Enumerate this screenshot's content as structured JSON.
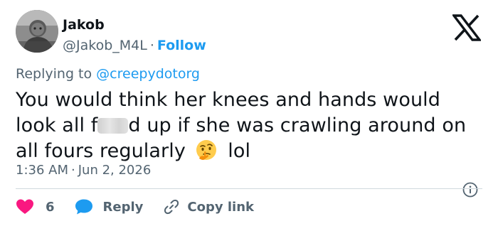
{
  "author": {
    "display_name": "Jakob",
    "handle": "@Jakob_M4L",
    "separator": "·",
    "follow_label": "Follow",
    "avatar_icon": "profile-avatar"
  },
  "platform": {
    "logo_icon": "x-logo-icon"
  },
  "reply_context": {
    "prefix": "Replying to",
    "mention": "@creepydotorg"
  },
  "tweet": {
    "text_before_censor": "You would think her knees and hands would look all f",
    "text_after_censor": "d up if she was crawling around on all fours regularly",
    "censor_icon": "censor-blur",
    "emoji_icon": "thinking-face-emoji",
    "text_after_emoji": "lol"
  },
  "meta": {
    "time": "1:36 AM",
    "separator": "·",
    "date": "Jun 2, 2026",
    "info_icon": "info-icon"
  },
  "actions": {
    "like_count": "6",
    "reply_label": "Reply",
    "copy_label": "Copy link"
  },
  "colors": {
    "accent": "#1d9bf0",
    "like": "#f91880",
    "text": "#0f1419",
    "secondary": "#536471",
    "divider": "#cfd9de"
  }
}
